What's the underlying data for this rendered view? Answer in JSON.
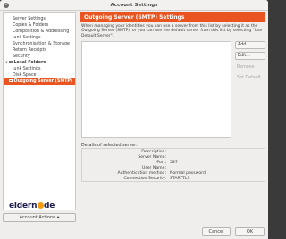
{
  "window": {
    "title": "Account Settings",
    "close_glyph": "×"
  },
  "sidebar": {
    "items": [
      {
        "label": "Server Settings"
      },
      {
        "label": "Copies & Folders"
      },
      {
        "label": "Composition & Addressing"
      },
      {
        "label": "Junk Settings"
      },
      {
        "label": "Synchronisation & Storage"
      },
      {
        "label": "Return Receipts"
      },
      {
        "label": "Security"
      },
      {
        "label": "Local Folders"
      },
      {
        "label": "Junk Settings"
      },
      {
        "label": "Disk Space"
      },
      {
        "label": "Outgoing Server (SMTP)"
      }
    ],
    "selected_index": 10,
    "account_actions_label": "Account Actions"
  },
  "logo": {
    "text_before": "eldern",
    "text_after": "de"
  },
  "panel": {
    "title": "Outgoing Server (SMTP) Settings",
    "description": "When managing your identities you can use a server from this list by selecting it as the Outgoing Server (SMTP), or you can use the default server from this list by selecting \"Use Default Server\".",
    "buttons": {
      "add": "Add...",
      "edit": "Edit...",
      "remove": "Remove",
      "set_default": "Set Default"
    }
  },
  "details": {
    "heading": "Details of selected server:",
    "rows": [
      {
        "key": "Description:",
        "value": ""
      },
      {
        "key": "Server Name:",
        "value": ""
      },
      {
        "key": "Port:",
        "value": "587"
      },
      {
        "key": "User Name:",
        "value": ""
      },
      {
        "key": "Authentication method:",
        "value": "Normal password"
      },
      {
        "key": "Connection Security:",
        "value": "STARTTLS"
      }
    ]
  },
  "dialog": {
    "cancel": "Cancel",
    "ok": "OK"
  },
  "colors": {
    "accent": "#e95420",
    "logo_dark": "#1d1d4f",
    "logo_orange": "#f39c12"
  }
}
